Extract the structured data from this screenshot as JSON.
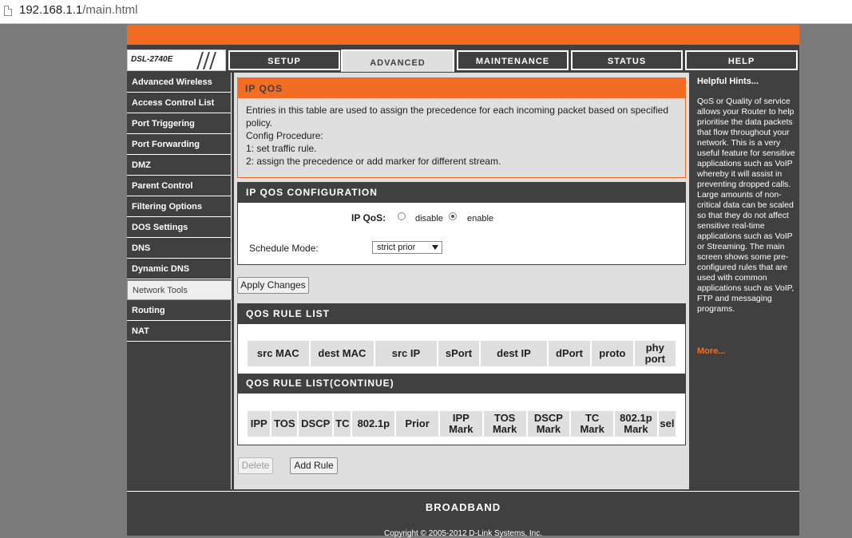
{
  "browser": {
    "url_host": "192.168.1.1",
    "url_path": "/main.html"
  },
  "header": {
    "model": "DSL-2740E"
  },
  "tabs": [
    {
      "label": "SETUP",
      "active": false
    },
    {
      "label": "ADVANCED",
      "active": true
    },
    {
      "label": "MAINTENANCE",
      "active": false
    },
    {
      "label": "STATUS",
      "active": false
    },
    {
      "label": "HELP",
      "active": false
    }
  ],
  "sidebar": {
    "items": [
      {
        "label": "Advanced Wireless"
      },
      {
        "label": "Access Control List"
      },
      {
        "label": "Port Triggering"
      },
      {
        "label": "Port Forwarding"
      },
      {
        "label": "DMZ"
      },
      {
        "label": "Parent Control"
      },
      {
        "label": "Filtering Options"
      },
      {
        "label": "DOS Settings"
      },
      {
        "label": "DNS"
      },
      {
        "label": "Dynamic DNS"
      },
      {
        "label": "Network Tools",
        "selected": true
      },
      {
        "label": "Routing"
      },
      {
        "label": "NAT"
      }
    ]
  },
  "intro": {
    "title": "IP QOS",
    "lines": [
      "Entries in this table are used to assign the precedence for each incoming packet based on specified",
      "policy.",
      "Config Procedure:",
      "1: set traffic rule.",
      "2: assign the precedence or add marker for different stream."
    ]
  },
  "config": {
    "title": "IP QOS CONFIGURATION",
    "qos_label": "IP QoS:",
    "disable_label": "disable",
    "enable_label": "enable",
    "selected": "enable",
    "schedule_label": "Schedule Mode:",
    "schedule_value": "strict prior"
  },
  "apply_label": "Apply Changes",
  "rule_list": {
    "title": "QOS RULE LIST",
    "columns": [
      "src MAC",
      "dest MAC",
      "src IP",
      "sPort",
      "dest IP",
      "dPort",
      "proto",
      "phy\nport"
    ]
  },
  "rule_list_continue": {
    "title": "QOS RULE LIST(CONTINUE)",
    "columns": [
      "IPP",
      "TOS",
      "DSCP",
      "TC",
      "802.1p",
      "Prior",
      "IPP\nMark",
      "TOS\nMark",
      "DSCP\nMark",
      "TC\nMark",
      "802.1p\nMark",
      "sel"
    ]
  },
  "buttons": {
    "delete_label": "Delete",
    "add_label": "Add Rule"
  },
  "hints": {
    "title": "Helpful Hints...",
    "body": "QoS or Quality of service allows your Router to help prioritise the data packets that flow throughout your network. This is a very useful feature for sensitive applications such as VoIP whereby it will assist in preventing dropped calls. Large amounts of non-critical data can be scaled so that they do not affect sensitive real-time applications such as VoIP or Streaming. The main screen shows some pre-configured rules that are used with common applications such as VoIP, FTP and messaging programs.",
    "more_label": "More..."
  },
  "footer": {
    "brand": "BROADBAND",
    "copyright": "Copyright © 2005-2012 D-Link Systems, Inc."
  },
  "colors": {
    "accent": "#f26c23",
    "dark": "#404040",
    "panel": "#dfdfdf"
  }
}
